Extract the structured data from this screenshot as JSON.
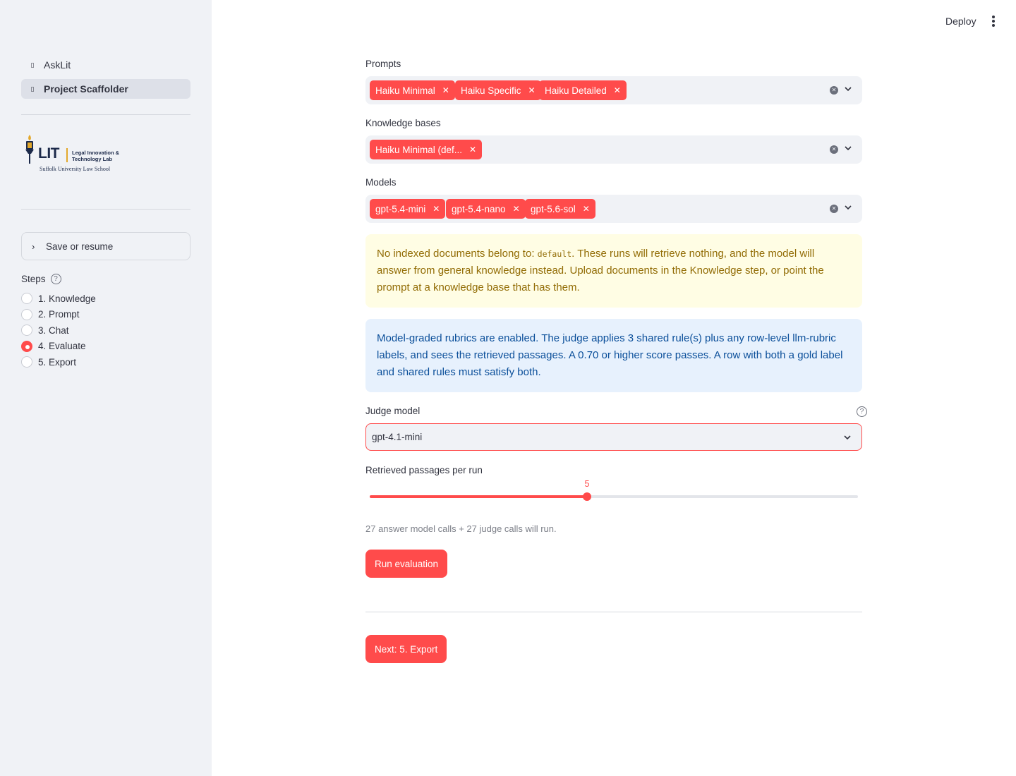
{
  "sidebar": {
    "nav": [
      {
        "label": "AskLit",
        "icon": "page-icon",
        "active": false
      },
      {
        "label": "Project Scaffolder",
        "icon": "page-icon",
        "active": true
      }
    ],
    "logo": {
      "wordmark": "LIT",
      "lab_line1": "Legal Innovation &",
      "lab_line2": "Technology Lab",
      "school": "Suffolk University Law School"
    },
    "expander_label": "Save or resume",
    "steps": {
      "label": "Steps",
      "options": [
        "1. Knowledge",
        "2. Prompt",
        "3. Chat",
        "4. Evaluate",
        "5. Export"
      ],
      "selected_index": 3
    }
  },
  "header": {
    "deploy_label": "Deploy",
    "menu_icon": "kebab-menu-icon"
  },
  "main": {
    "prompts": {
      "label": "Prompts",
      "chips": [
        "Haiku Minimal",
        "Haiku Specific",
        "Haiku Detailed"
      ]
    },
    "knowledge_bases": {
      "label": "Knowledge bases",
      "chips": [
        "Haiku Minimal (def..."
      ]
    },
    "models": {
      "label": "Models",
      "chips": [
        "gpt-5.4-mini",
        "gpt-5.4-nano",
        "gpt-5.6-sol"
      ]
    },
    "warning": {
      "before": "No indexed documents belong to: ",
      "code": "default",
      "after": ". These runs will retrieve nothing, and the model will answer from general knowledge instead. Upload documents in the Knowledge step, or point the prompt at a knowledge base that has them."
    },
    "info": {
      "text": "Model-graded rubrics are enabled. The judge applies 3 shared rule(s) plus any row-level llm-rubric labels, and sees the retrieved passages. A 0.70 or higher score passes. A row with both a gold label and shared rules must satisfy both."
    },
    "judge_model": {
      "label": "Judge model",
      "value": "gpt-4.1-mini"
    },
    "passages": {
      "label": "Retrieved passages per run",
      "value": "5",
      "fill_fraction": 0.445
    },
    "caption": "27 answer model calls + 27 judge calls will run.",
    "run_button": "Run evaluation",
    "next_button": "Next: 5. Export"
  },
  "colors": {
    "accent": "#ff4b4b",
    "sidebar_bg": "#f0f2f6",
    "warning_bg": "#fffde4",
    "warning_text": "#926c05",
    "info_bg": "#e7f1fd",
    "info_text": "#0b4f9a"
  }
}
